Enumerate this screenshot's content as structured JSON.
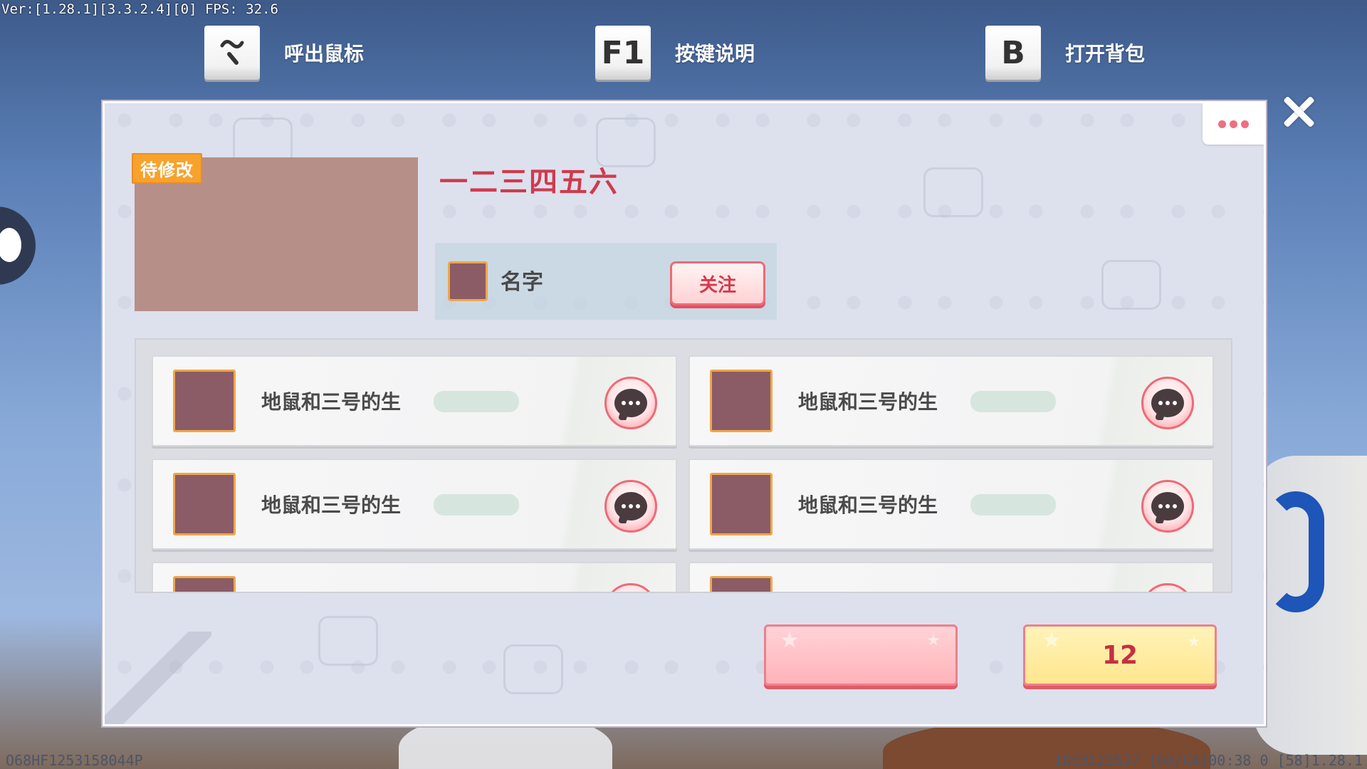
{
  "debug": {
    "top_left": "Ver:[1.28.1][3.3.2.4][0] FPS: 32.6",
    "bottom_left": "O68HF1253158044P",
    "bottom_right": "1059125537   [08/04]00:38 0   [58]1.28.1"
  },
  "hints": [
    {
      "key": "~",
      "label": "呼出鼠标"
    },
    {
      "key": "F1",
      "label": "按键说明"
    },
    {
      "key": "B",
      "label": "打开背包"
    }
  ],
  "panel": {
    "tag": "待修改",
    "title": "一二三四五六",
    "author": {
      "name": "名字",
      "follow_label": "关注"
    },
    "cards": [
      {
        "name": "地鼠和三号的生"
      },
      {
        "name": "地鼠和三号的生"
      },
      {
        "name": "地鼠和三号的生"
      },
      {
        "name": "地鼠和三号的生"
      },
      {
        "name": ""
      },
      {
        "name": ""
      }
    ],
    "yellow_button_label": "12"
  },
  "icons": {
    "more": "more-dots-icon",
    "close": "close-icon",
    "chat": "chat-bubble-icon"
  },
  "colors": {
    "accent_red": "#d03a4e",
    "tag_orange": "#f7a22d",
    "avatar_placeholder": "#8b5c66",
    "cover_placeholder": "#b68f88"
  }
}
